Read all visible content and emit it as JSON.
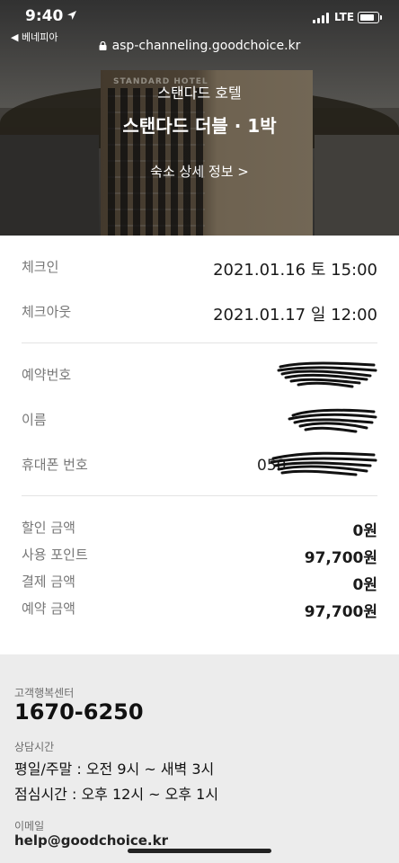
{
  "status": {
    "time": "9:40",
    "back_app": "◀ 베네피아",
    "network": "LTE"
  },
  "browser": {
    "url": "asp-channeling.goodchoice.kr"
  },
  "hero": {
    "hotel_name": "스탠다드 호텔",
    "room_title": "스탠다드 더블 · 1박",
    "detail_link": "숙소 상세 정보 >",
    "building_sign": "STANDARD HOTEL"
  },
  "booking": {
    "checkin": {
      "label": "체크인",
      "value": "2021.01.16 토 15:00"
    },
    "checkout": {
      "label": "체크아웃",
      "value": "2021.01.17 일 12:00"
    },
    "reservation_no": {
      "label": "예약번호"
    },
    "name": {
      "label": "이름"
    },
    "phone": {
      "label": "휴대폰 번호",
      "visible_prefix": "050"
    },
    "discount": {
      "label": "할인 금액",
      "value": "0원"
    },
    "points": {
      "label": "사용 포인트",
      "value": "97,700원"
    },
    "payment": {
      "label": "결제 금액",
      "value": "0원"
    },
    "total": {
      "label": "예약 금액",
      "value": "97,700원"
    }
  },
  "footer": {
    "cs_label": "고객행복센터",
    "cs_phone": "1670-6250",
    "hours_label": "상담시간",
    "hours_weekday": "평일/주말 : 오전 9시 ~ 새벽 3시",
    "hours_lunch": "점심시간 : 오후 12시 ~ 오후 1시",
    "email_label": "이메일",
    "email": "help@goodchoice.kr"
  }
}
